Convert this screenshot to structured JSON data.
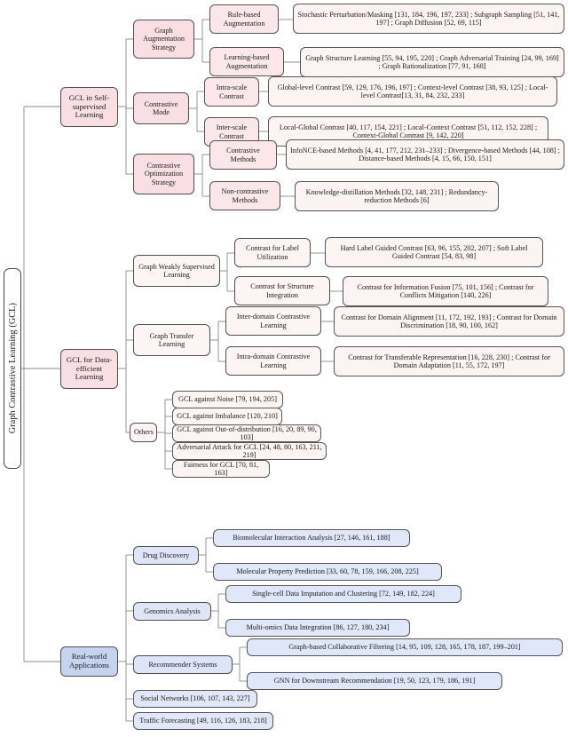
{
  "root": {
    "label": "Graph Contrastive Learning (GCL)"
  },
  "branches": [
    {
      "id": "ssl",
      "label": "GCL in Self-supervised Learning",
      "children": [
        {
          "label": "Graph Augmentation Strategy",
          "children": [
            {
              "label": "Rule-based Augmentation",
              "leaf": "Stochastic Perturbation/Masking [131, 184, 196, 197, 233] ; Subgraph Sampling [51, 141, 197] ; Graph Diffusion [52, 69, 115]"
            },
            {
              "label": "Learning-based Augmentation",
              "leaf": "Graph Structure Learning [55, 94, 195, 220] ; Graph Adversarial Training [24, 99, 169] ; Graph Rationalization [77, 91, 168]"
            }
          ]
        },
        {
          "label": "Contrastive Mode",
          "children": [
            {
              "label": "Intra-scale Contrast",
              "leaf": "Global-level Contrast [59, 129, 176, 196, 197] ; Context-level Contrast [38, 93, 125] ; Local-level Contrast[13, 31, 84, 232, 233]"
            },
            {
              "label": "Inter-scale Contrast",
              "leaf": "Local-Global Contrast [40, 117, 154, 221] ; Local-Context Contrast [51, 112, 152, 228] ; Context-Global Contrast [9, 142, 220]"
            }
          ]
        },
        {
          "label": "Contrastive Optimization Strategy",
          "children": [
            {
              "label": "Contrastive Methods",
              "leaf": "InfoNCE-based Methods [4, 41, 177, 212, 231–233] ; Divergence-based Methods [44, 108] ; Distance-based Methods [4, 15, 66, 150, 151]"
            },
            {
              "label": "Non-contrastive Methods",
              "leaf": "Knowledge-distillation Methods [32, 148, 231] ; Redundancy-reduction Methods [6]"
            }
          ]
        }
      ]
    },
    {
      "id": "dataeff",
      "label": "GCL for Data-efficient Learning",
      "children": [
        {
          "label": "Graph Weakly Supervised Learning",
          "children": [
            {
              "label": "Contrast for Label Utilization",
              "leaf": "Hard Label Guided Contrast [63, 96, 155, 202, 207] ; Soft Label Guided Contrast [54, 83, 98]"
            },
            {
              "label": "Contrast for Structure Integration",
              "leaf": "Contrast for Information Fusion [75, 101, 156] ; Contrast for Conflicts Mitigation [140, 226]"
            }
          ]
        },
        {
          "label": "Graph Transfer Learning",
          "children": [
            {
              "label": "Inter-domain Contrastive Learning",
              "leaf": "Contrast for Domain Alignment [11, 172, 192, 193] ; Contrast for Domain Discrimination [18, 90, 100, 162]"
            },
            {
              "label": "Intra-domain Contrastive Learning",
              "leaf": "Contrast for Transferable Representation [16, 228, 230] ; Contrast for Domain Adaptation [11, 55, 172, 197]"
            }
          ]
        },
        {
          "label": "Others",
          "leaves": [
            "GCL against Noise [79, 194, 205]",
            "GCL against Imbalance [120, 210]",
            "GCL against Out-of-distribution [16, 20, 89, 90, 103]",
            "Adversarial Attack for GCL [24, 48, 80, 163, 211, 219]",
            "Fairness for GCL [70, 81, 163]"
          ]
        }
      ]
    },
    {
      "id": "apps",
      "label": "Real-world Applications",
      "children": [
        {
          "label": "Drug Discovery",
          "leaves": [
            "Biomolecular Interaction Analysis [27, 146, 161, 188]",
            "Molecular Property Prediction [33, 60, 78, 159, 166, 208, 225]"
          ]
        },
        {
          "label": "Genomics Analysis",
          "leaves": [
            "Single-cell Data Imputation and Clustering [72, 149, 182, 224]",
            "Multi-omics Data Integration [86, 127, 180, 234]"
          ]
        },
        {
          "label": "Recommender Systems",
          "leaves": [
            "Graph-based Collaborative Filtering [14, 95, 109, 128, 165, 178, 187, 199–201]",
            "GNN for Downstream Recommendation [19, 50, 123, 179, 186, 191]"
          ]
        }
      ],
      "direct_leaves": [
        "Social Networks [106, 107, 143, 227]",
        "Traffic Forecasting [49, 116, 126, 183, 218]"
      ]
    }
  ],
  "colors": {
    "pink_node": "#f9dfe3",
    "pink_leaf": "#fcf4f2",
    "blue_node": "#c5d3ee",
    "blue_leaf": "#dfe7f8",
    "edge": "#8a8a8a",
    "border": "#555555"
  }
}
